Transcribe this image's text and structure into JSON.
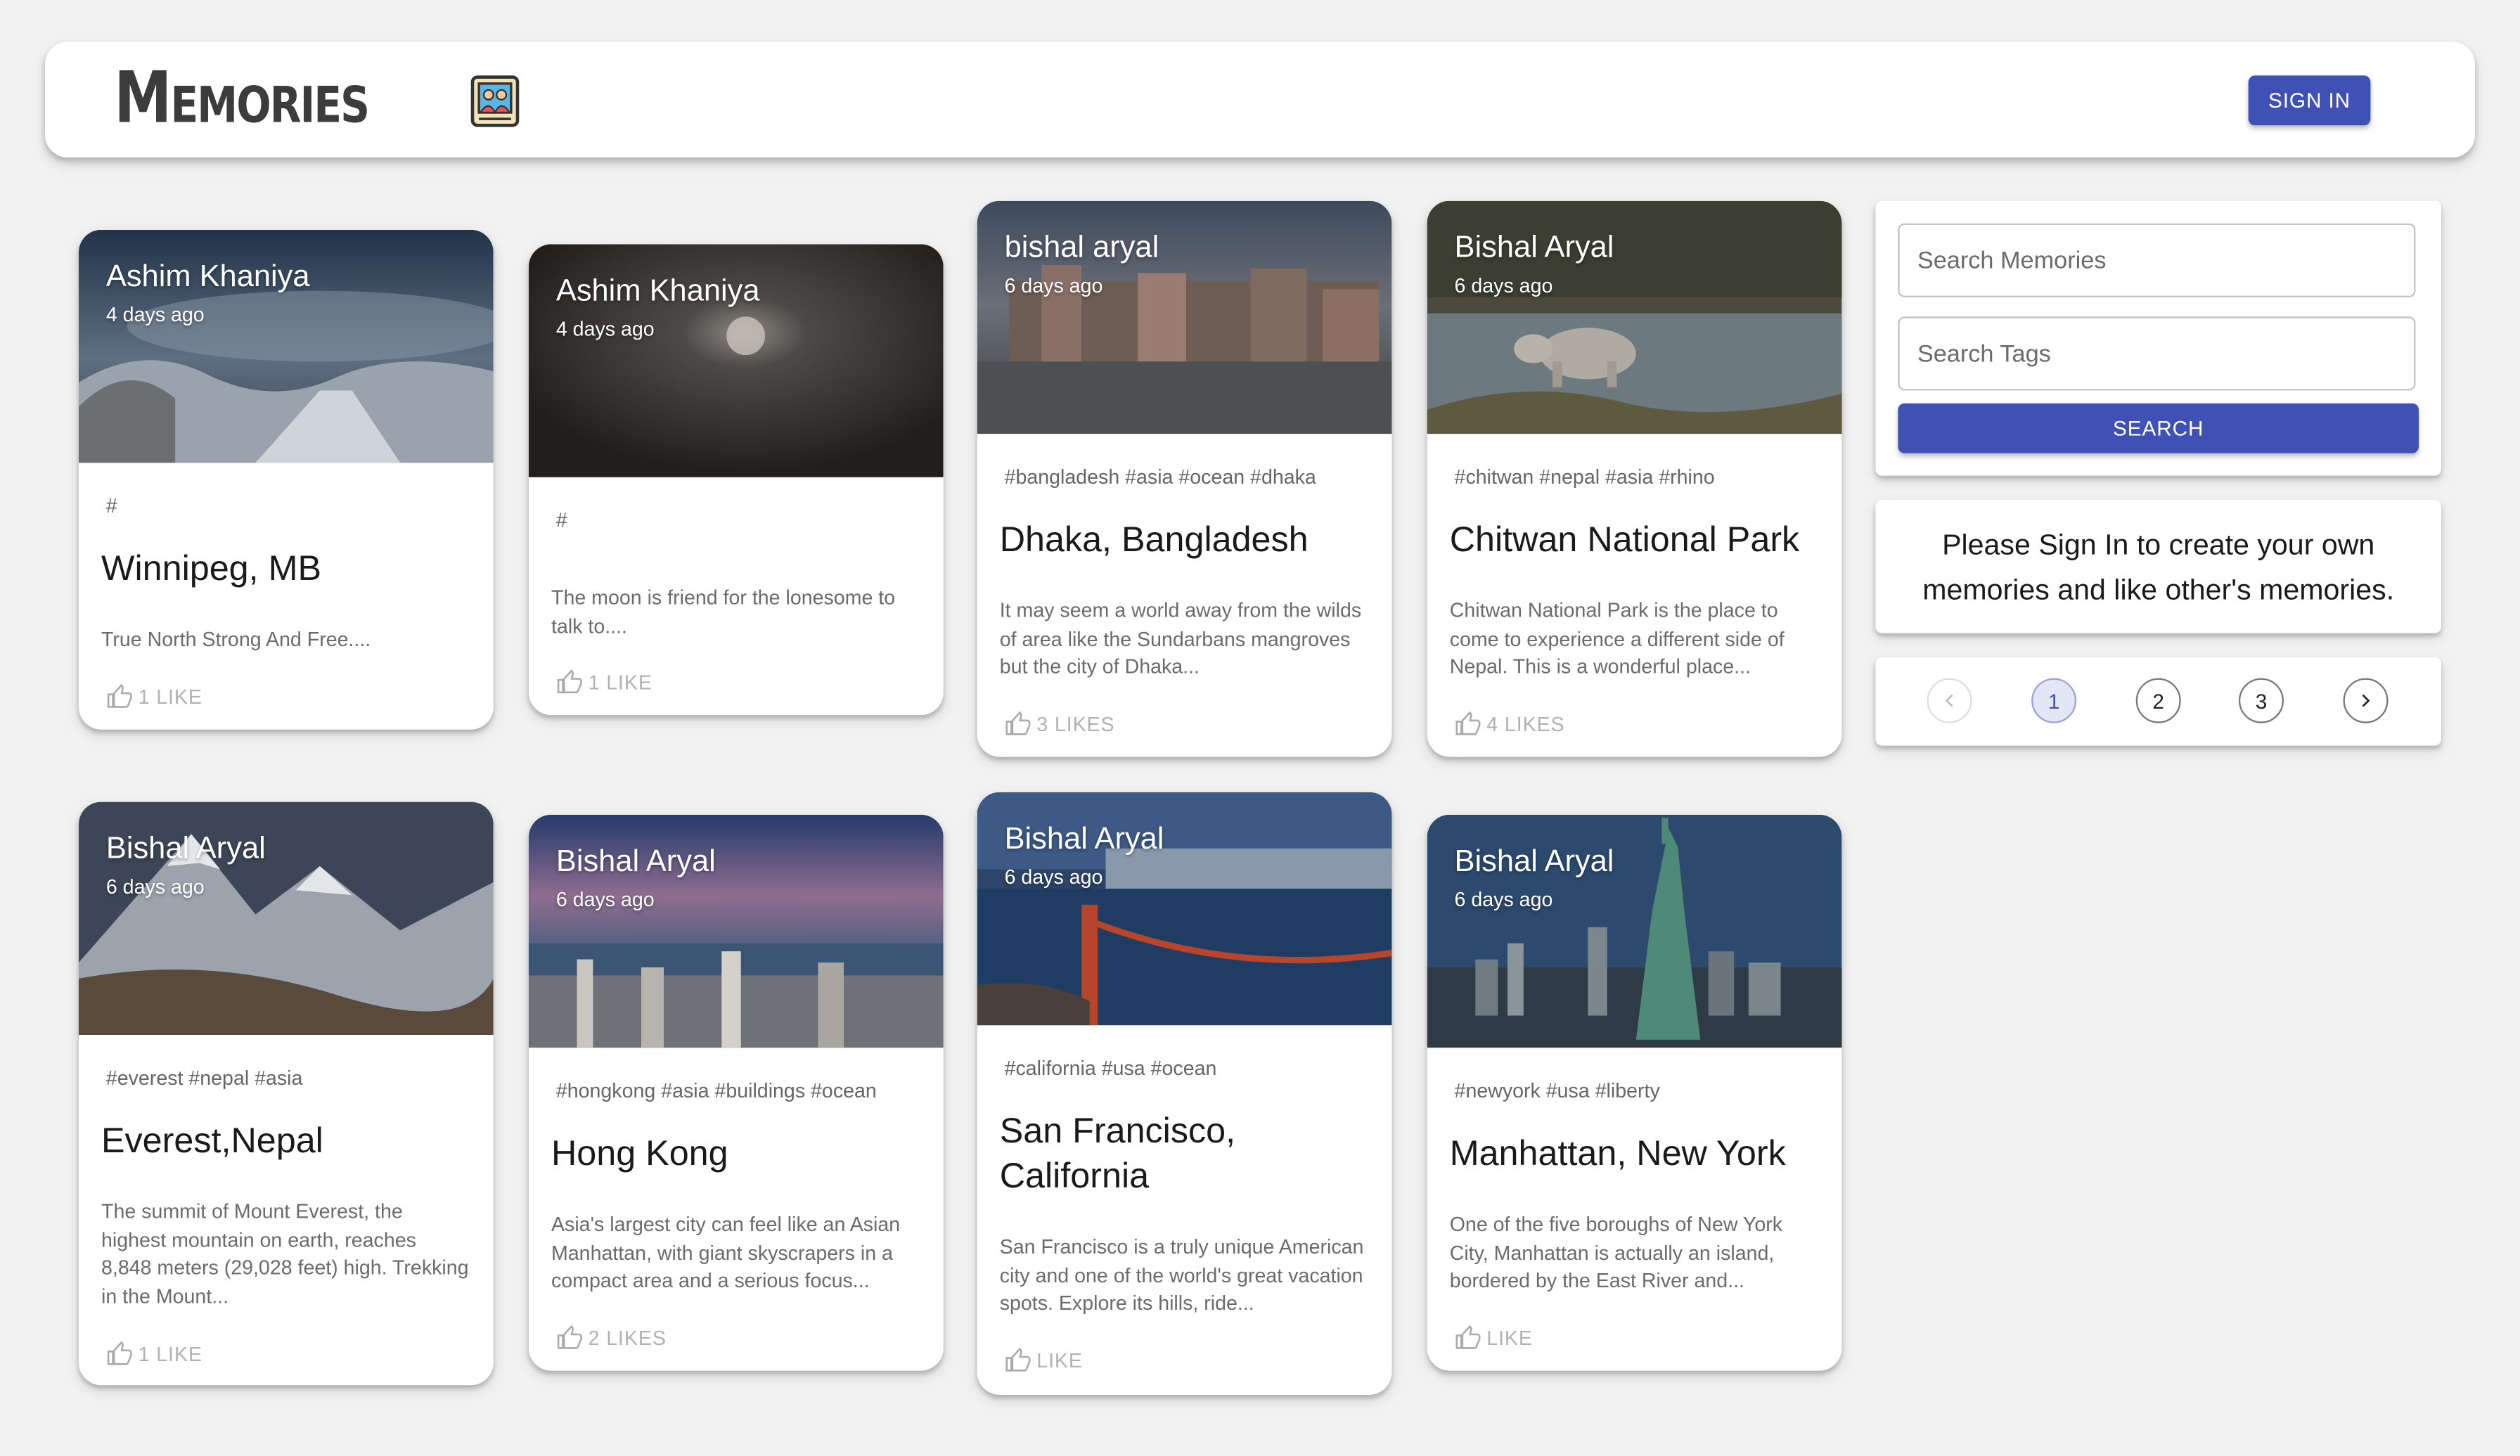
{
  "header": {
    "brand": "Memories",
    "brand_icon": "photo-album-icon",
    "signin_label": "SIGN IN"
  },
  "posts": [
    {
      "author": "Ashim Khaniya",
      "time": "4 days ago",
      "tags": "#",
      "title": "Winnipeg, MB",
      "description": "True North Strong And Free....",
      "likes": "1 LIKE"
    },
    {
      "author": "Ashim Khaniya",
      "time": "4 days ago",
      "tags": "#",
      "title": "",
      "description": "The moon is friend for the lonesome to talk to....",
      "likes": "1 LIKE"
    },
    {
      "author": "bishal aryal",
      "time": "6 days ago",
      "tags": "#bangladesh #asia #ocean #dhaka",
      "title": "Dhaka, Bangladesh",
      "description": "It may seem a world away from the wilds of area like the Sundarbans mangroves but the city of Dhaka...",
      "likes": "3 LIKES"
    },
    {
      "author": "Bishal Aryal",
      "time": "6 days ago",
      "tags": "#chitwan #nepal #asia #rhino",
      "title": "Chitwan National Park",
      "description": "Chitwan National Park is the place to come to experience a different side of Nepal. This is a wonderful place...",
      "likes": "4 LIKES"
    },
    {
      "author": "Bishal Aryal",
      "time": "6 days ago",
      "tags": "#everest #nepal #asia",
      "title": "Everest,Nepal",
      "description": "The summit of Mount Everest, the highest mountain on earth, reaches 8,848 meters (29,028 feet) high. Trekking in the Mount...",
      "likes": "1 LIKE"
    },
    {
      "author": "Bishal Aryal",
      "time": "6 days ago",
      "tags": "#hongkong #asia #buildings #ocean",
      "title": "Hong Kong",
      "description": "Asia's largest city can feel like an Asian Manhattan, with giant skyscrapers in a compact area and a serious focus...",
      "likes": "2 LIKES"
    },
    {
      "author": "Bishal Aryal",
      "time": "6 days ago",
      "tags": "#california #usa #ocean",
      "title": "San Francisco, California",
      "description": "San Francisco is a truly unique American city and one of the world's great vacation spots. Explore its hills, ride...",
      "likes": "LIKE"
    },
    {
      "author": "Bishal Aryal",
      "time": "6 days ago",
      "tags": "#newyork #usa #liberty",
      "title": "Manhattan, New York",
      "description": "One of the five boroughs of New York City, Manhattan is actually an island, bordered by the East River and...",
      "likes": "LIKE"
    }
  ],
  "search": {
    "memories_placeholder": "Search Memories",
    "tags_placeholder": "Search Tags",
    "button_label": "SEARCH"
  },
  "notice": "Please Sign In to create your own memories and like other's memories.",
  "pagination": {
    "pages": [
      "1",
      "2",
      "3"
    ],
    "current": "1",
    "prev_icon": "chevron-left-icon",
    "next_icon": "chevron-right-icon"
  },
  "colors": {
    "primary": "#3f51b5",
    "background": "#f1f1f1"
  }
}
